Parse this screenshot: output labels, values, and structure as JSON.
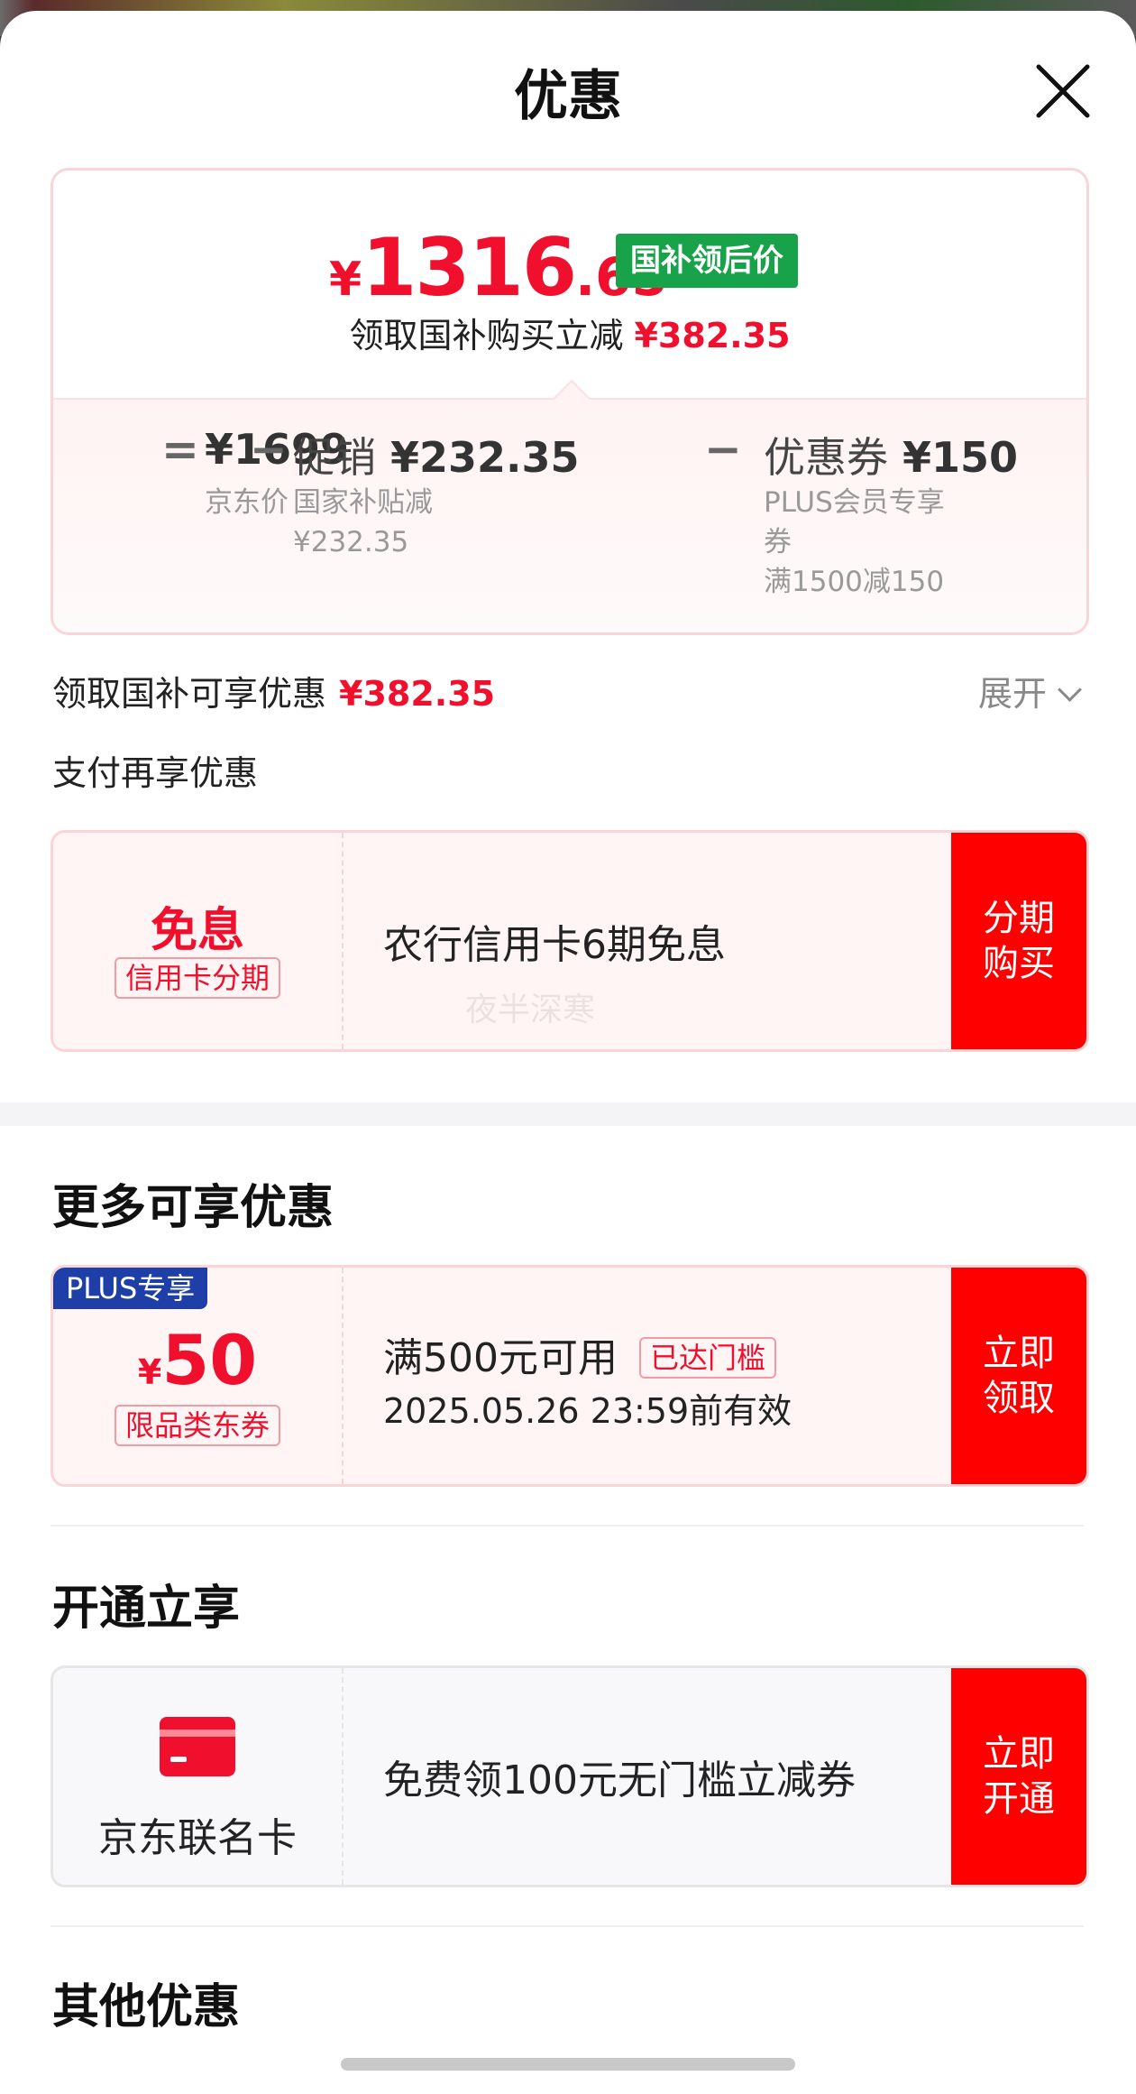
{
  "sheet": {
    "title": "优惠"
  },
  "price_summary": {
    "currency": "¥",
    "price_int": "1316",
    "price_dec": ".65",
    "badge": "国补领后价",
    "subtitle": "领取国补购买立减",
    "subtitle_amount": "¥382.35"
  },
  "breakdown": {
    "eq": "=",
    "minus": "−",
    "jd_price": "¥1699",
    "jd_price_label": "京东价",
    "promo_label": "促销",
    "promo_amount": "¥232.35",
    "promo_note_1": "国家补贴减",
    "promo_note_2": "¥232.35",
    "coupon_label": "优惠券",
    "coupon_amount": "¥150",
    "coupon_note_1": "PLUS会员专享",
    "coupon_note_2": "券",
    "coupon_note_3": "满1500减150"
  },
  "national_subsidy_row": {
    "label": "领取国补可享优惠",
    "amount": "¥382.35",
    "expand_label": "展开"
  },
  "payment_section": {
    "title": "支付再享优惠",
    "card": {
      "left_title": "免息",
      "left_tag": "信用卡分期",
      "desc": "农行信用卡6期免息",
      "cta_line1": "分期",
      "cta_line2": "购买"
    },
    "watermark": "夜半深寒"
  },
  "more_section": {
    "title": "更多可享优惠",
    "card": {
      "plus_tag": "PLUS专享",
      "currency": "¥",
      "amount": "50",
      "left_tag": "限品类东券",
      "condition": "满500元可用",
      "status_tag": "已达门槛",
      "validity": "2025.05.26 23:59前有效",
      "cta_line1": "立即",
      "cta_line2": "领取"
    }
  },
  "open_section": {
    "title": "开通立享",
    "card": {
      "name": "京东联名卡",
      "desc": "免费领100元无门槛立减券",
      "cta_line1": "立即",
      "cta_line2": "开通"
    }
  },
  "other_section": {
    "title": "其他优惠"
  },
  "colors": {
    "accent_red": "#f0102e",
    "cta_red": "#ff0000",
    "badge_green": "#18a34a",
    "plus_blue": "#1e3fa8"
  }
}
